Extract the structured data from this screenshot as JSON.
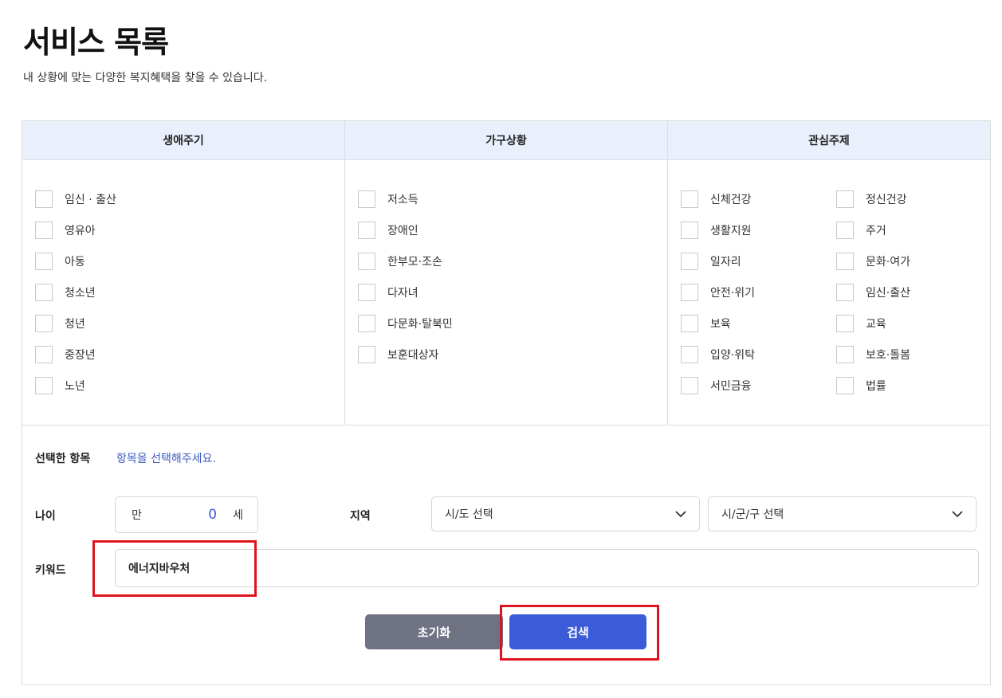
{
  "page": {
    "title": "서비스 목록",
    "description": "내 상황에 맞는 다양한 복지혜택을 찾을 수 있습니다."
  },
  "categories": {
    "life_cycle": {
      "title": "생애주기",
      "items": [
        "임신 · 출산",
        "영유아",
        "아동",
        "청소년",
        "청년",
        "중장년",
        "노년"
      ]
    },
    "household": {
      "title": "가구상황",
      "items": [
        "저소득",
        "장애인",
        "한부모·조손",
        "다자녀",
        "다문화·탈북민",
        "보훈대상자"
      ]
    },
    "interest": {
      "title": "관심주제",
      "items_left": [
        "신체건강",
        "생활지원",
        "일자리",
        "안전·위기",
        "보육",
        "입양·위탁",
        "서민금융"
      ],
      "items_right": [
        "정신건강",
        "주거",
        "문화·여가",
        "임신·출산",
        "교육",
        "보호·돌봄",
        "법률"
      ]
    }
  },
  "selected": {
    "label": "선택한 항목",
    "message": "항목을 선택해주세요."
  },
  "age": {
    "label": "나이",
    "prefix": "만",
    "value": "0",
    "suffix": "세"
  },
  "region": {
    "label": "지역",
    "sido_placeholder": "시/도 선택",
    "sigungu_placeholder": "시/군/구 선택"
  },
  "keyword": {
    "label": "키워드",
    "value": "에너지바우처"
  },
  "buttons": {
    "reset": "초기화",
    "search": "검색"
  },
  "colors": {
    "accent": "#3b5bd9",
    "reset_button": "#6e7282",
    "header_bg": "#eaf0fb",
    "highlight": "#e0141e"
  }
}
